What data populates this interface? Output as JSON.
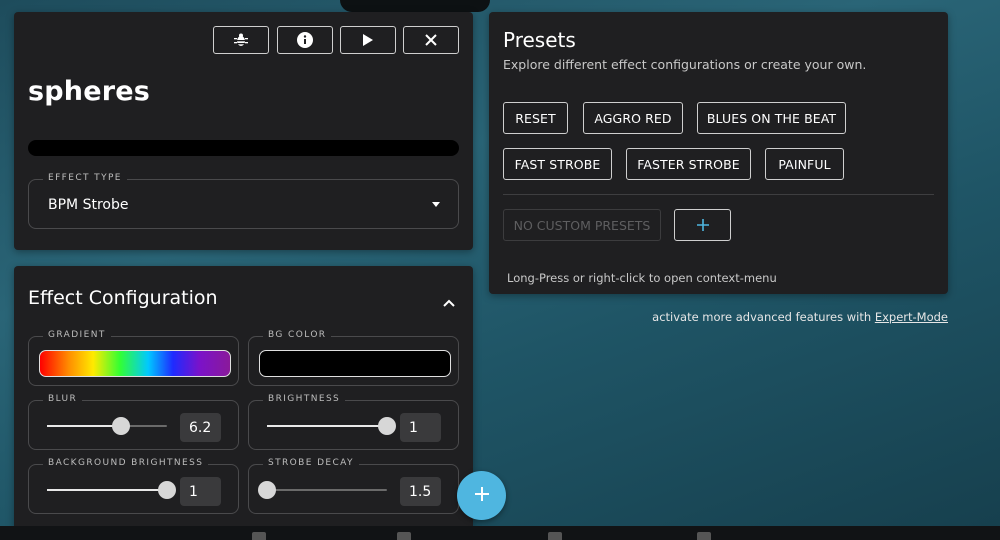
{
  "effect": {
    "name": "spheres",
    "toolbar": {
      "debug_icon": "bug-icon",
      "info_icon": "info-icon",
      "play_icon": "play-icon",
      "close_icon": "close-icon"
    },
    "type_label": "EFFECT TYPE",
    "type_value": "BPM Strobe"
  },
  "config": {
    "title": "Effect Configuration",
    "gradient_label": "GRADIENT",
    "bg_color_label": "BG COLOR",
    "bg_color_value": "#000000",
    "blur": {
      "label": "BLUR",
      "value": "6.2",
      "fraction": 0.62
    },
    "brightness": {
      "label": "BRIGHTNESS",
      "value": "1",
      "fraction": 1.0
    },
    "background_brightness": {
      "label": "BACKGROUND BRIGHTNESS",
      "value": "1",
      "fraction": 1.0
    },
    "strobe_decay": {
      "label": "STROBE DECAY",
      "value": "1.5",
      "fraction": 0.0
    }
  },
  "presets": {
    "title": "Presets",
    "subtitle": "Explore different effect configurations or create your own.",
    "buttons": [
      "RESET",
      "AGGRO RED",
      "BLUES ON THE BEAT",
      "FAST STROBE",
      "FASTER STROBE",
      "PAINFUL"
    ],
    "no_custom_label": "NO CUSTOM PRESETS",
    "hint": "Long-Press or right-click to open context-menu"
  },
  "expert": {
    "text": "activate more advanced features with ",
    "link": "Expert-Mode"
  },
  "colors": {
    "accent": "#4fb6e0",
    "card_bg": "#1f1f21"
  }
}
